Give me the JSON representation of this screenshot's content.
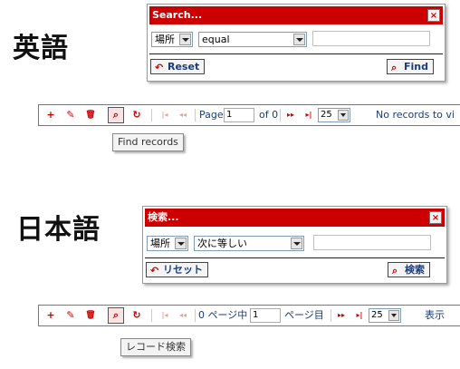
{
  "english": {
    "heading": "英語",
    "dialog": {
      "title": "Search...",
      "close": "×",
      "field_select": "場所",
      "operator_select": "equal",
      "search_value": "",
      "reset_label": "Reset",
      "find_label": "Find"
    },
    "pager": {
      "page_label": "Page",
      "page_value": "1",
      "of_label": "of 0",
      "rows_value": "25",
      "records_info": "No records to vi"
    },
    "tooltip": "Find records"
  },
  "japanese": {
    "heading": "日本語",
    "dialog": {
      "title": "検索...",
      "close": "×",
      "field_select": "場所",
      "operator_select": "次に等しい",
      "search_value": "",
      "reset_label": "リセット",
      "find_label": "検索"
    },
    "pager": {
      "page_label": "0 ページ中",
      "page_value": "1",
      "of_label": "ページ目",
      "rows_value": "25",
      "records_info": "表示"
    },
    "tooltip": "レコード検索"
  },
  "icons": {
    "add": "+",
    "edit": "✎",
    "delete": "🗑",
    "search": "⌕",
    "refresh": "↻",
    "first": "|◂",
    "prev": "◂◂",
    "next": "▸▸",
    "last": "▸|",
    "reset": "↶"
  },
  "colors": {
    "titlebar": "#cc0000",
    "icon_red": "#cc0000",
    "link_blue": "#1a3c7a"
  }
}
